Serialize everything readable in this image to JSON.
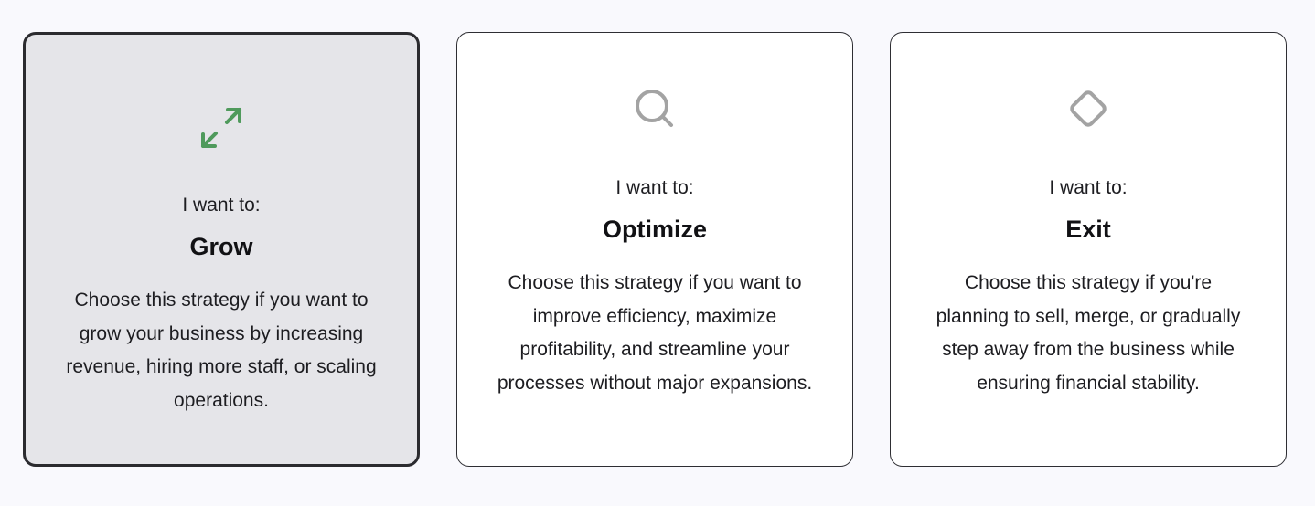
{
  "strategy_cards": [
    {
      "prompt": "I want to:",
      "title": "Grow",
      "description": "Choose this strategy if you want to grow your business by increasing revenue, hiring more staff, or scaling operations.",
      "icon": "expand-arrows-icon",
      "icon_color": "#4f9a5c",
      "selected": true
    },
    {
      "prompt": "I want to:",
      "title": "Optimize",
      "description": "Choose this strategy if you want to improve efficiency, maximize profitability, and streamline your processes without major expansions.",
      "icon": "magnifier-icon",
      "icon_color": "#a3a3a3",
      "selected": false
    },
    {
      "prompt": "I want to:",
      "title": "Exit",
      "description": "Choose this strategy if you're planning to sell, merge, or gradually step away from the business while ensuring financial stability.",
      "icon": "diamond-icon",
      "icon_color": "#a3a3a3",
      "selected": false
    }
  ],
  "colors": {
    "page_background": "#f9f9fd",
    "selected_card_background": "#e5e5e9",
    "card_background": "#ffffff",
    "text": "#1d1d21"
  }
}
